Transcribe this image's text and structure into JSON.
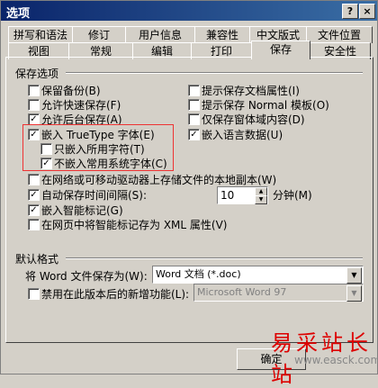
{
  "window": {
    "title": "选项",
    "help": "?",
    "close": "×"
  },
  "tabs_row1": [
    "拼写和语法",
    "修订",
    "用户信息",
    "兼容性",
    "中文版式",
    "文件位置"
  ],
  "tabs_row2": [
    "视图",
    "常规",
    "编辑",
    "打印",
    "保存",
    "安全性"
  ],
  "save_options": {
    "heading": "保存选项",
    "left": [
      {
        "label": "保留备份(B)",
        "checked": false
      },
      {
        "label": "允许快速保存(F)",
        "checked": false
      },
      {
        "label": "允许后台保存(A)",
        "checked": true
      },
      {
        "label": "嵌入 TrueType 字体(E)",
        "checked": true
      },
      {
        "label": "只嵌入所用字符(T)",
        "checked": false
      },
      {
        "label": "不嵌入常用系统字体(C)",
        "checked": true
      }
    ],
    "right": [
      {
        "label": "提示保存文档属性(I)",
        "checked": false
      },
      {
        "label": "提示保存 Normal 模板(O)",
        "checked": false
      },
      {
        "label": "仅保存窗体域内容(D)",
        "checked": false
      },
      {
        "label": "嵌入语言数据(U)",
        "checked": true
      }
    ],
    "network_copy": {
      "label": "在网络或可移动驱动器上存储文件的本地副本(W)",
      "checked": false
    },
    "autosave": {
      "label": "自动保存时间间隔(S):",
      "checked": true,
      "value": "10",
      "unit": "分钟(M)"
    },
    "smart_tags": {
      "label": "嵌入智能标记(G)",
      "checked": true
    },
    "xml": {
      "label": "在网页中将智能标记存为 XML 属性(V)",
      "checked": false
    }
  },
  "default_format": {
    "heading": "默认格式",
    "save_as_label": "将 Word 文件保存为(W):",
    "save_as_value": "Word 文档 (*.doc)",
    "disable_label": "禁用在此版本后的新增功能(L):",
    "disable_checked": false,
    "disable_value": "Microsoft Word 97"
  },
  "buttons": {
    "ok": "确定"
  },
  "watermark": {
    "text": "易采站长站",
    "sub": "www.easck.com"
  }
}
